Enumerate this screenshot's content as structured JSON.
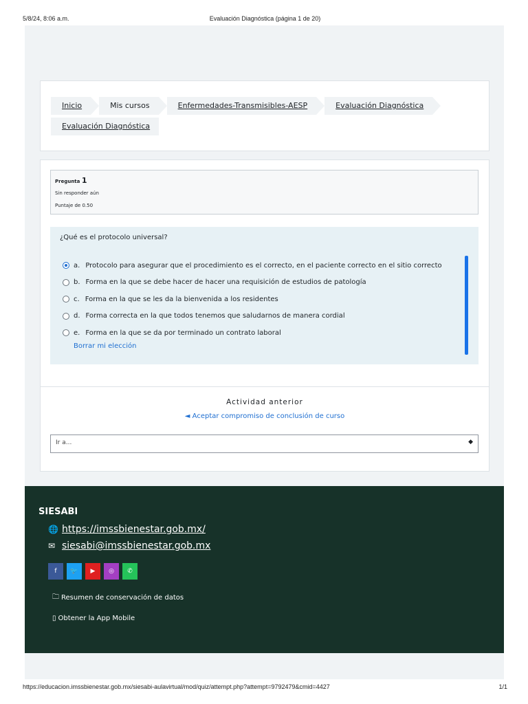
{
  "print_header": {
    "date": "5/8/24, 8:06 a.m.",
    "title": "Evaluación Diagnóstica (página 1 de 20)"
  },
  "print_footer": {
    "url": "https://educacion.imssbienestar.gob.mx/siesabi-aulavirtual/mod/quiz/attempt.php?attempt=9792479&cmid=4427",
    "pages": "1/1"
  },
  "breadcrumb": {
    "items": [
      {
        "label": "Inicio"
      },
      {
        "label": "Mis cursos"
      },
      {
        "label": "Enfermedades-Transmisibles-AESP"
      },
      {
        "label": "Evaluación Diagnóstica"
      },
      {
        "label": "Evaluación Diagnóstica"
      }
    ]
  },
  "question": {
    "label": "Pregunta",
    "number": "1",
    "status": "Sin responder aún",
    "score": "Puntaje de 0.50",
    "text": "¿Qué es el protocolo universal?",
    "answers": [
      {
        "letter": "a.",
        "text": "Protocolo para asegurar que el procedimiento es el correcto, en el paciente correcto en el sitio correcto",
        "selected": true
      },
      {
        "letter": "b.",
        "text": "Forma en la que se debe hacer de hacer una requisición de estudios de patología",
        "selected": false
      },
      {
        "letter": "c.",
        "text": "Forma en la que se les da la bienvenida a los residentes",
        "selected": false
      },
      {
        "letter": "d.",
        "text": "Forma correcta en la que todos tenemos que saludarnos de manera cordial",
        "selected": false
      },
      {
        "letter": "e.",
        "text": "Forma en la que se da por terminado un contrato laboral",
        "selected": false
      }
    ],
    "clear_label": "Borrar mi elección"
  },
  "navigation": {
    "prev_heading": "Actividad anterior",
    "prev_link": "◄ Aceptar compromiso de conclusión de curso",
    "jump_placeholder": "Ir a...",
    "jump_arrows": "◆"
  },
  "footer": {
    "brand": "SIESABI",
    "website": "https://imssbienestar.gob.mx/",
    "email": "siesabi@imssbienestar.gob.mx",
    "socials": [
      {
        "name": "facebook-icon",
        "glyph": "f",
        "color": "#3b5998"
      },
      {
        "name": "twitter-icon",
        "glyph": "🐦",
        "color": "#1da1f2"
      },
      {
        "name": "youtube-icon",
        "glyph": "▶",
        "color": "#e02020"
      },
      {
        "name": "instagram-icon",
        "glyph": "◎",
        "color": "#a43fc3"
      },
      {
        "name": "whatsapp-icon",
        "glyph": "✆",
        "color": "#25c35a"
      }
    ],
    "data_summary": "Resumen de conservación de datos",
    "app_mobile": "Obtener la App Mobile"
  },
  "colors": {
    "accent": "#1f6fd1",
    "footer_bg": "#173229",
    "page_bg": "#f0f3f5"
  }
}
